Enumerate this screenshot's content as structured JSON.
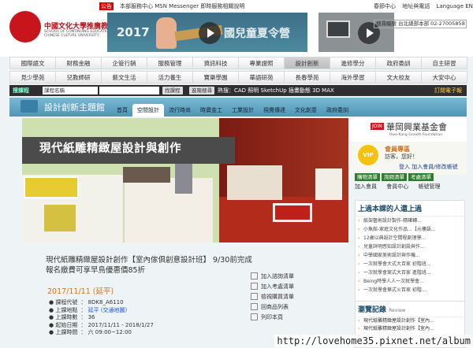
{
  "logo": {
    "title": "中國文化大學推廣教育部",
    "en1": "SCHOOL OF CONTINUING EDUCATION",
    "en2": "CHINESE CULTURE UNIVERSITY"
  },
  "notice": {
    "label": "公告",
    "text": "本部服務中心 MSN Messenger 即時服務相關說明"
  },
  "banner": {
    "year": "2017",
    "title": "國兒童夏令營"
  },
  "top_links": [
    "春節中心",
    "地址與電話",
    "Language ENGLISH"
  ],
  "lang": "上",
  "search_placeholder": "搜尋編號 台北總部本部 02-27005858",
  "nav1": [
    "國際語文",
    "財務金融",
    "企管行銷",
    "服務管理",
    "資訊科技",
    "專業證照",
    "設計創新",
    "進修學分",
    "政府委訓",
    "自主研習"
  ],
  "nav2": [
    "見少學苑",
    "兒教師研",
    "藝文生活",
    "活力養生",
    "寶樂學園",
    "華語研苑",
    "長春學苑",
    "海外學習",
    "文大校友",
    "大安中心"
  ],
  "searchbar": {
    "title": "搜課程",
    "select": "課程名稱",
    "btn1": "找課程",
    "btn2": "進階搜尋",
    "hot_label": "熱搜：",
    "hot": "CAD 照明 SketchUp 插畫動態 3D MAX",
    "print": "訂閱電子報"
  },
  "subnav": {
    "title": "設計創新主題館",
    "tabs": [
      "首頁",
      "空間設計",
      "流行時尚",
      "時寶金工",
      "工業設計",
      "視覺傳達",
      "文化創意",
      "政府委訓"
    ],
    "selected": 1
  },
  "hero": {
    "title": "現代紙雕精緻屋設計與創作"
  },
  "partner": {
    "join": "JOIN",
    "name": "華岡興業基金會",
    "sub": "Hwa-Kang Growth Foundation"
  },
  "member": {
    "title": "會員專區",
    "hello": "訪客，您好！",
    "links": "登入 加入會員/修改帳號",
    "tabs": [
      "購物清單",
      "詢問清單",
      "考處清單"
    ],
    "row1": "加入會員",
    "row2": "會員中心",
    "row3": "帳號管理"
  },
  "who": {
    "title": "上過本課的人還上過",
    "items": [
      "紙架藝術設計製作-精確轉...",
      "小魚館-家庭文化作品...【元樓語...",
      "12歲以典設計空間程創理學...",
      "兒童詳明感知設計創設與作...",
      "中學國家美術設計與作機...",
      "一次就學會大式大百家 初階班...",
      "一次就學會案式大百家 進階班...",
      "Being時學人人一次就學會...",
      "一次就學會華式火百家 初階..."
    ]
  },
  "recent": {
    "title": "瀏覽記錄",
    "sub": "Review",
    "items": [
      "現代紙雕精緻屋設計創作【室內...",
      "現代紙雕精緻屋設計創作【室內..."
    ]
  },
  "course": {
    "title": "現代紙雕精緻屋設計創作【室內傢俱創意設計班】 9/30前完成報名繳費可享早鳥優惠價85折",
    "date": "2017/11/11 (延平)",
    "fields": [
      {
        "k": "課程代號",
        "v": "8DK8_A6110"
      },
      {
        "k": "上課地點",
        "v": "延平 (交通地圖)"
      },
      {
        "k": "上課時數",
        "v": "36"
      },
      {
        "k": "起始日期",
        "v": "2017/11/11 - 2018/1/27"
      },
      {
        "k": "上課時間",
        "v": "六 09:00~12:00"
      }
    ]
  },
  "actions": [
    "加入諮詢清單",
    "加入考處清單",
    "檢視購買清單",
    "回商品列表",
    "列印本頁"
  ],
  "watermark": "http://lovehome35.pixnet.net/album"
}
